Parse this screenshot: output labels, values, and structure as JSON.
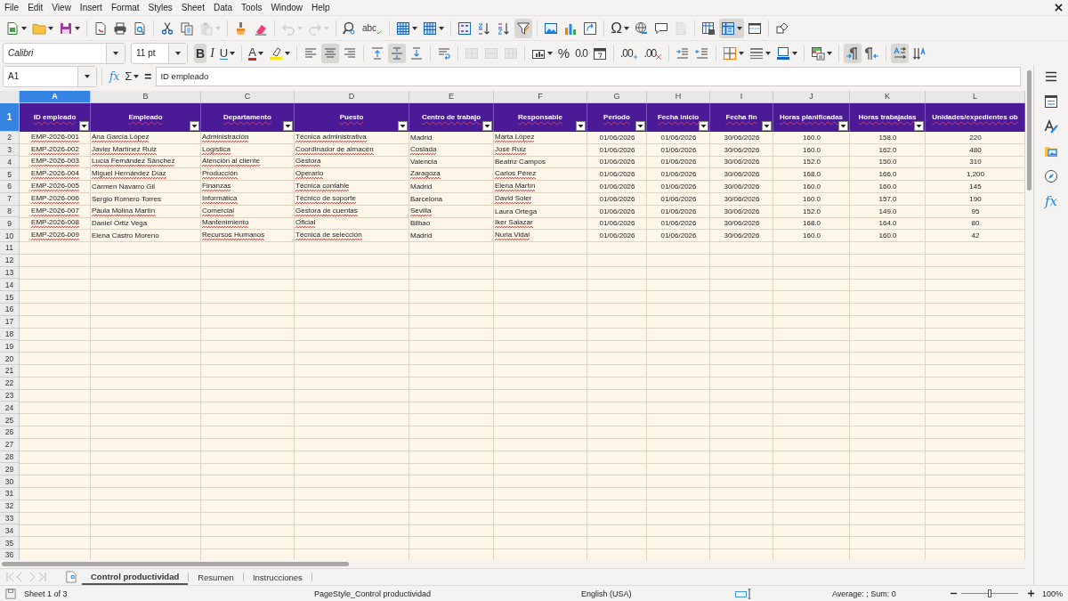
{
  "menu": [
    "File",
    "Edit",
    "View",
    "Insert",
    "Format",
    "Styles",
    "Sheet",
    "Data",
    "Tools",
    "Window",
    "Help"
  ],
  "standard_toolbar": [
    {
      "kind": "new",
      "on": false,
      "disabled": false
    },
    {
      "kind": "open",
      "on": false,
      "disabled": false
    },
    {
      "kind": "save",
      "on": false,
      "disabled": false
    },
    {
      "kind": "sep"
    },
    {
      "kind": "pdf",
      "on": false,
      "disabled": false
    },
    {
      "kind": "print",
      "on": false,
      "disabled": false
    },
    {
      "kind": "preview",
      "on": false,
      "disabled": false
    },
    {
      "kind": "sep"
    },
    {
      "kind": "cut",
      "on": false,
      "disabled": false
    },
    {
      "kind": "copy",
      "on": false,
      "disabled": false
    },
    {
      "kind": "paste",
      "on": false,
      "disabled": true
    },
    {
      "kind": "sep"
    },
    {
      "kind": "clone",
      "on": false,
      "disabled": false
    },
    {
      "kind": "clear",
      "on": false,
      "disabled": false
    },
    {
      "kind": "sep"
    },
    {
      "kind": "undo",
      "on": false,
      "disabled": true
    },
    {
      "kind": "redo",
      "on": false,
      "disabled": true
    },
    {
      "kind": "sep"
    },
    {
      "kind": "find",
      "on": false,
      "disabled": false
    },
    {
      "kind": "spelling",
      "glyph": "abc",
      "on": false,
      "disabled": false
    },
    {
      "kind": "sep"
    },
    {
      "kind": "row",
      "on": false,
      "disabled": false
    },
    {
      "kind": "column",
      "on": false,
      "disabled": false
    },
    {
      "kind": "sep"
    },
    {
      "kind": "sort",
      "on": false,
      "disabled": false
    },
    {
      "kind": "sortasc",
      "on": false,
      "disabled": false
    },
    {
      "kind": "sortdesc",
      "on": false,
      "disabled": false
    },
    {
      "kind": "autofilter",
      "on": true,
      "disabled": false
    },
    {
      "kind": "sep"
    },
    {
      "kind": "image",
      "on": false,
      "disabled": false
    },
    {
      "kind": "chart",
      "on": false,
      "disabled": false
    },
    {
      "kind": "pivot",
      "on": false,
      "disabled": false
    },
    {
      "kind": "sep"
    },
    {
      "kind": "special",
      "glyph": "Ω",
      "on": false,
      "disabled": false
    },
    {
      "kind": "hyperlink",
      "on": false,
      "disabled": false
    },
    {
      "kind": "comment",
      "on": false,
      "disabled": false
    },
    {
      "kind": "headerfooter",
      "on": false,
      "disabled": true
    },
    {
      "kind": "sep"
    },
    {
      "kind": "printarea",
      "on": false,
      "disabled": false
    },
    {
      "kind": "freeze",
      "on": true,
      "disabled": false
    },
    {
      "kind": "split",
      "on": false,
      "disabled": false
    },
    {
      "kind": "sep"
    },
    {
      "kind": "shapes",
      "on": false,
      "disabled": false
    }
  ],
  "formatting_toolbar": {
    "font": "Calibri",
    "size": "11 pt",
    "items": [
      {
        "kind": "bold",
        "glyph": "B",
        "on": true,
        "disabled": false
      },
      {
        "kind": "italic",
        "glyph": "I",
        "on": false,
        "disabled": false
      },
      {
        "kind": "underline",
        "glyph": "U",
        "on": false,
        "disabled": false
      },
      {
        "kind": "sep"
      },
      {
        "kind": "fontcolor",
        "glyph": "A",
        "on": false,
        "disabled": false
      },
      {
        "kind": "highlight",
        "on": false,
        "disabled": false
      },
      {
        "kind": "sep"
      },
      {
        "kind": "alignleft",
        "on": false,
        "disabled": false
      },
      {
        "kind": "aligncenter",
        "on": true,
        "disabled": false
      },
      {
        "kind": "alignright",
        "on": false,
        "disabled": false
      },
      {
        "kind": "sep"
      },
      {
        "kind": "aligntop",
        "on": false,
        "disabled": false
      },
      {
        "kind": "alignmiddle",
        "on": true,
        "disabled": false
      },
      {
        "kind": "alignbottom",
        "on": false,
        "disabled": false
      },
      {
        "kind": "sep"
      },
      {
        "kind": "wrap",
        "on": false,
        "disabled": false
      },
      {
        "kind": "sep"
      },
      {
        "kind": "mergecenter",
        "on": false,
        "disabled": true
      },
      {
        "kind": "merge",
        "on": false,
        "disabled": true
      },
      {
        "kind": "unmerge",
        "on": false,
        "disabled": true
      },
      {
        "kind": "sep"
      },
      {
        "kind": "currency",
        "on": false,
        "disabled": false
      },
      {
        "kind": "percent",
        "glyph": "%",
        "on": false,
        "disabled": false
      },
      {
        "kind": "number",
        "glyph": "0.0",
        "on": false,
        "disabled": false
      },
      {
        "kind": "date",
        "on": false,
        "disabled": false
      },
      {
        "kind": "sep"
      },
      {
        "kind": "adddecimal",
        "glyph": ".00",
        "on": false,
        "disabled": false
      },
      {
        "kind": "deldecimal",
        "glyph": ".00",
        "on": false,
        "disabled": false
      },
      {
        "kind": "sep"
      },
      {
        "kind": "indent",
        "on": false,
        "disabled": false
      },
      {
        "kind": "outdent",
        "on": false,
        "disabled": false
      },
      {
        "kind": "sep"
      },
      {
        "kind": "borders",
        "on": false,
        "disabled": false
      },
      {
        "kind": "borderstyle",
        "on": false,
        "disabled": false
      },
      {
        "kind": "bordercolor",
        "on": false,
        "disabled": false
      },
      {
        "kind": "sep"
      },
      {
        "kind": "conditional",
        "on": false,
        "disabled": false
      },
      {
        "kind": "sep"
      },
      {
        "kind": "ltr",
        "on": true,
        "disabled": false
      },
      {
        "kind": "rtl",
        "on": false,
        "disabled": false
      },
      {
        "kind": "sep"
      },
      {
        "kind": "horizontaltext",
        "on": true,
        "disabled": false
      },
      {
        "kind": "verticaltext",
        "on": false,
        "disabled": false
      }
    ]
  },
  "formula_bar": {
    "cell": "A1",
    "function_wizard": "fx",
    "sum": "Σ",
    "equals": "=",
    "value": "ID empleado"
  },
  "sheet": {
    "columns": [
      {
        "letter": "A",
        "selected": true,
        "header": "ID empleado",
        "filter": true
      },
      {
        "letter": "B",
        "selected": false,
        "header": "Empleado",
        "filter": true
      },
      {
        "letter": "C",
        "selected": false,
        "header": "Departamento",
        "filter": true
      },
      {
        "letter": "D",
        "selected": false,
        "header": "Puesto",
        "filter": true
      },
      {
        "letter": "E",
        "selected": false,
        "header": "Centro de trabajo",
        "filter": true
      },
      {
        "letter": "F",
        "selected": false,
        "header": "Responsable",
        "filter": true
      },
      {
        "letter": "G",
        "selected": false,
        "header": "Periodo",
        "filter": true
      },
      {
        "letter": "H",
        "selected": false,
        "header": "Fecha inicio",
        "filter": true
      },
      {
        "letter": "I",
        "selected": false,
        "header": "Fecha fin",
        "filter": true
      },
      {
        "letter": "J",
        "selected": false,
        "header": "Horas planificadas",
        "filter": true
      },
      {
        "letter": "K",
        "selected": false,
        "header": "Horas trabajadas",
        "filter": true
      },
      {
        "letter": "L",
        "selected": false,
        "header": "Unidades/expedientes ob",
        "filter": false
      }
    ],
    "header_row": {
      "number": "1",
      "selected": true
    },
    "rows": [
      {
        "number": "2",
        "selected": false,
        "cells": [
          {
            "text": "EMP-2026-001",
            "flagged": true
          },
          {
            "text": "Ana García López",
            "flagged": true
          },
          {
            "text": "Administración",
            "flagged": true
          },
          {
            "text": "Técnica administrativa",
            "flagged": true
          },
          {
            "text": "Madrid",
            "flagged": false
          },
          {
            "text": "Marta López",
            "flagged": true
          },
          {
            "text": "01/06/2026",
            "flagged": false
          },
          {
            "text": "01/06/2026",
            "flagged": false
          },
          {
            "text": "30/06/2026",
            "flagged": false
          },
          {
            "text": "160.0",
            "flagged": false
          },
          {
            "text": "158.0",
            "flagged": false
          },
          {
            "text": "220",
            "flagged": false
          }
        ]
      },
      {
        "number": "3",
        "selected": false,
        "cells": [
          {
            "text": "EMP-2026-002",
            "flagged": true
          },
          {
            "text": "Javier Martínez Ruiz",
            "flagged": true
          },
          {
            "text": "Logística",
            "flagged": true
          },
          {
            "text": "Coordinador de almacén",
            "flagged": true
          },
          {
            "text": "Coslada",
            "flagged": true
          },
          {
            "text": "José Ruiz",
            "flagged": true
          },
          {
            "text": "01/06/2026",
            "flagged": false
          },
          {
            "text": "01/06/2026",
            "flagged": false
          },
          {
            "text": "30/06/2026",
            "flagged": false
          },
          {
            "text": "160.0",
            "flagged": false
          },
          {
            "text": "162.0",
            "flagged": false
          },
          {
            "text": "480",
            "flagged": false
          }
        ]
      },
      {
        "number": "4",
        "selected": false,
        "cells": [
          {
            "text": "EMP-2026-003",
            "flagged": true
          },
          {
            "text": "Lucía Fernández Sánchez",
            "flagged": true
          },
          {
            "text": "Atención al cliente",
            "flagged": true
          },
          {
            "text": "Gestora",
            "flagged": true
          },
          {
            "text": "Valencia",
            "flagged": false
          },
          {
            "text": "Beatriz Campos",
            "flagged": false
          },
          {
            "text": "01/06/2026",
            "flagged": false
          },
          {
            "text": "01/06/2026",
            "flagged": false
          },
          {
            "text": "30/06/2026",
            "flagged": false
          },
          {
            "text": "152.0",
            "flagged": false
          },
          {
            "text": "150.0",
            "flagged": false
          },
          {
            "text": "310",
            "flagged": false
          }
        ]
      },
      {
        "number": "5",
        "selected": false,
        "cells": [
          {
            "text": "EMP-2026-004",
            "flagged": true
          },
          {
            "text": "Miguel Hernández Díaz",
            "flagged": true
          },
          {
            "text": "Producción",
            "flagged": true
          },
          {
            "text": "Operario",
            "flagged": true
          },
          {
            "text": "Zaragoza",
            "flagged": true
          },
          {
            "text": "Carlos Pérez",
            "flagged": true
          },
          {
            "text": "01/06/2026",
            "flagged": false
          },
          {
            "text": "01/06/2026",
            "flagged": false
          },
          {
            "text": "30/06/2026",
            "flagged": false
          },
          {
            "text": "168.0",
            "flagged": false
          },
          {
            "text": "166.0",
            "flagged": false
          },
          {
            "text": "1,200",
            "flagged": false
          }
        ]
      },
      {
        "number": "6",
        "selected": false,
        "cells": [
          {
            "text": "EMP-2026-005",
            "flagged": true
          },
          {
            "text": "Carmen Navarro Gil",
            "flagged": false
          },
          {
            "text": "Finanzas",
            "flagged": true
          },
          {
            "text": "Técnica contable",
            "flagged": true
          },
          {
            "text": "Madrid",
            "flagged": false
          },
          {
            "text": "Elena Martín",
            "flagged": true
          },
          {
            "text": "01/06/2026",
            "flagged": false
          },
          {
            "text": "01/06/2026",
            "flagged": false
          },
          {
            "text": "30/06/2026",
            "flagged": false
          },
          {
            "text": "160.0",
            "flagged": false
          },
          {
            "text": "160.0",
            "flagged": false
          },
          {
            "text": "145",
            "flagged": false
          }
        ]
      },
      {
        "number": "7",
        "selected": false,
        "cells": [
          {
            "text": "EMP-2026-006",
            "flagged": true
          },
          {
            "text": "Sergio Romero Torres",
            "flagged": false
          },
          {
            "text": "Informática",
            "flagged": true
          },
          {
            "text": "Técnico de soporte",
            "flagged": true
          },
          {
            "text": "Barcelona",
            "flagged": false
          },
          {
            "text": "David Soler",
            "flagged": true
          },
          {
            "text": "01/06/2026",
            "flagged": false
          },
          {
            "text": "01/06/2026",
            "flagged": false
          },
          {
            "text": "30/06/2026",
            "flagged": false
          },
          {
            "text": "160.0",
            "flagged": false
          },
          {
            "text": "157.0",
            "flagged": false
          },
          {
            "text": "190",
            "flagged": false
          }
        ]
      },
      {
        "number": "8",
        "selected": false,
        "cells": [
          {
            "text": "EMP-2026-007",
            "flagged": true
          },
          {
            "text": "Paula Molina Martín",
            "flagged": true
          },
          {
            "text": "Comercial",
            "flagged": true
          },
          {
            "text": "Gestora de cuentas",
            "flagged": true
          },
          {
            "text": "Sevilla",
            "flagged": true
          },
          {
            "text": "Laura Ortega",
            "flagged": false
          },
          {
            "text": "01/06/2026",
            "flagged": false
          },
          {
            "text": "01/06/2026",
            "flagged": false
          },
          {
            "text": "30/06/2026",
            "flagged": false
          },
          {
            "text": "152.0",
            "flagged": false
          },
          {
            "text": "149.0",
            "flagged": false
          },
          {
            "text": "95",
            "flagged": false
          }
        ]
      },
      {
        "number": "9",
        "selected": false,
        "cells": [
          {
            "text": "EMP-2026-008",
            "flagged": true
          },
          {
            "text": "Daniel Ortiz Vega",
            "flagged": false
          },
          {
            "text": "Mantenimiento",
            "flagged": true
          },
          {
            "text": "Oficial",
            "flagged": true
          },
          {
            "text": "Bilbao",
            "flagged": false
          },
          {
            "text": "Iker Salazar",
            "flagged": true
          },
          {
            "text": "01/06/2026",
            "flagged": false
          },
          {
            "text": "01/06/2026",
            "flagged": false
          },
          {
            "text": "30/06/2026",
            "flagged": false
          },
          {
            "text": "168.0",
            "flagged": false
          },
          {
            "text": "164.0",
            "flagged": false
          },
          {
            "text": "80",
            "flagged": false
          }
        ]
      },
      {
        "number": "10",
        "selected": false,
        "cells": [
          {
            "text": "EMP-2026-009",
            "flagged": true
          },
          {
            "text": "Elena Castro Moreno",
            "flagged": false
          },
          {
            "text": "Recursos Humanos",
            "flagged": true
          },
          {
            "text": "Técnica de selección",
            "flagged": true
          },
          {
            "text": "Madrid",
            "flagged": false
          },
          {
            "text": "Nuria Vidal",
            "flagged": true
          },
          {
            "text": "01/06/2026",
            "flagged": false
          },
          {
            "text": "01/06/2026",
            "flagged": false
          },
          {
            "text": "30/06/2026",
            "flagged": false
          },
          {
            "text": "160.0",
            "flagged": false
          },
          {
            "text": "160.0",
            "flagged": false
          },
          {
            "text": "42",
            "flagged": false
          }
        ]
      },
      {
        "number": "11",
        "selected": false
      },
      {
        "number": "12",
        "selected": false
      },
      {
        "number": "13",
        "selected": false
      },
      {
        "number": "14",
        "selected": false
      },
      {
        "number": "15",
        "selected": false
      },
      {
        "number": "16",
        "selected": false
      },
      {
        "number": "17",
        "selected": false
      },
      {
        "number": "18",
        "selected": false
      },
      {
        "number": "19",
        "selected": false
      },
      {
        "number": "20",
        "selected": false
      },
      {
        "number": "21",
        "selected": false
      },
      {
        "number": "22",
        "selected": false
      },
      {
        "number": "23",
        "selected": false
      },
      {
        "number": "24",
        "selected": false
      },
      {
        "number": "25",
        "selected": false
      },
      {
        "number": "26",
        "selected": false
      },
      {
        "number": "27",
        "selected": false
      },
      {
        "number": "28",
        "selected": false
      },
      {
        "number": "29",
        "selected": false
      },
      {
        "number": "30",
        "selected": false
      },
      {
        "number": "31",
        "selected": false
      },
      {
        "number": "32",
        "selected": false
      },
      {
        "number": "33",
        "selected": false
      },
      {
        "number": "34",
        "selected": false
      },
      {
        "number": "35",
        "selected": false
      },
      {
        "number": "36",
        "selected": false
      }
    ]
  },
  "sheet_tabs": [
    {
      "label": "Control productividad",
      "selected": true
    },
    {
      "label": "Resumen",
      "selected": false
    },
    {
      "label": "Instrucciones",
      "selected": false
    }
  ],
  "sidebar": {
    "functions": "fx"
  },
  "status_bar": {
    "sheet": "Sheet 1 of 3",
    "page_style": "PageStyle_Control productividad",
    "language": "English (USA)",
    "summary": "Average: ; Sum: 0",
    "zoom": {
      "level": 0.5,
      "reading": "100%"
    }
  }
}
